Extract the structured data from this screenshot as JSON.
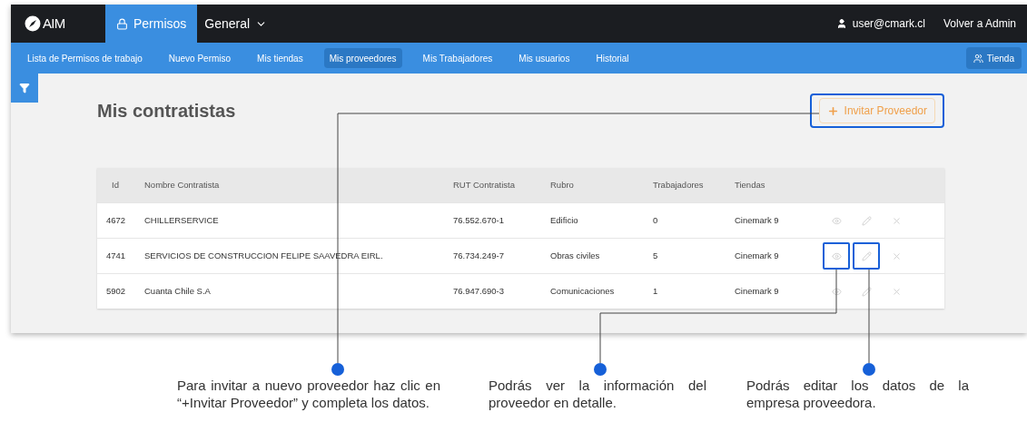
{
  "nav": {
    "logo": "AIM",
    "tabs": [
      {
        "label": "Permisos",
        "selected": true,
        "kind": "lock"
      },
      {
        "label": "General",
        "selected": false,
        "kind": "dropdown"
      }
    ],
    "user": "user@cmark.cl",
    "admin_link": "Volver a Admin"
  },
  "subnav": {
    "items": [
      {
        "label": "Lista de Permisos de trabajo",
        "selected": false
      },
      {
        "label": "Nuevo Permiso",
        "selected": false
      },
      {
        "label": "Mis tiendas",
        "selected": false
      },
      {
        "label": "Mis proveedores",
        "selected": true
      },
      {
        "label": "Mis Trabajadores",
        "selected": false
      },
      {
        "label": "Mis usuarios",
        "selected": false
      },
      {
        "label": "Historial",
        "selected": false
      }
    ],
    "store_button": "Tienda"
  },
  "page": {
    "title": "Mis contratistas",
    "invite_button": {
      "label": "Invitar Proveedor",
      "highlighted": true
    }
  },
  "table": {
    "columns": [
      "Id",
      "Nombre Contratista",
      "RUT Contratista",
      "Rubro",
      "Trabajadores",
      "Tiendas"
    ],
    "rows": [
      {
        "cells": [
          "4672",
          "CHILLERSERVICE",
          "76.552.670-1",
          "Edificio",
          "0",
          "Cinemark 9"
        ],
        "actions": [
          {
            "kind": "view",
            "highlighted": false
          },
          {
            "kind": "edit",
            "highlighted": false
          },
          {
            "kind": "delete",
            "highlighted": false
          }
        ]
      },
      {
        "cells": [
          "4741",
          "SERVICIOS DE CONSTRUCCION FELIPE SAAVEDRA EIRL.",
          "76.734.249-7",
          "Obras civiles",
          "5",
          "Cinemark 9"
        ],
        "actions": [
          {
            "kind": "view",
            "highlighted": true
          },
          {
            "kind": "edit",
            "highlighted": true
          },
          {
            "kind": "delete",
            "highlighted": false
          }
        ]
      },
      {
        "cells": [
          "5902",
          "Cuanta Chile S.A",
          "76.947.690-3",
          "Comunicaciones",
          "1",
          "Cinemark 9"
        ],
        "actions": [
          {
            "kind": "view",
            "highlighted": false
          },
          {
            "kind": "edit",
            "highlighted": false
          },
          {
            "kind": "delete",
            "highlighted": false
          }
        ]
      }
    ]
  },
  "annotations": [
    {
      "text": "Para invitar a nuevo proveedor haz clic en “+Invitar Proveedor” y completa los datos."
    },
    {
      "text": "Podrás ver la información del proveedor en detalle."
    },
    {
      "text": "Podrás editar los datos de la empresa proveedora."
    }
  ]
}
